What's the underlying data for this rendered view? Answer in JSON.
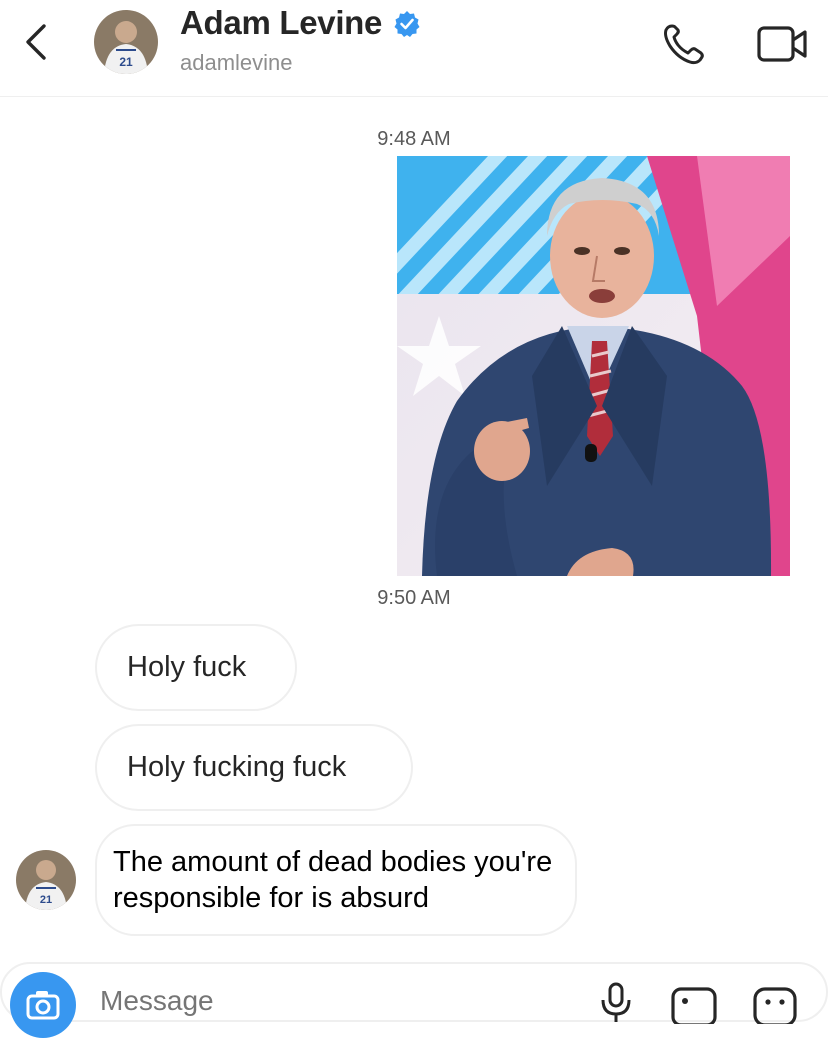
{
  "header": {
    "name": "Adam Levine",
    "handle": "adamlevine",
    "verified": true,
    "icons": [
      "back-chevron-icon",
      "verified-badge-icon",
      "phone-icon",
      "video-camera-icon"
    ]
  },
  "thread": {
    "timestamps": [
      "9:48 AM",
      "9:50 AM"
    ],
    "messages": [
      {
        "from": "them",
        "text": "Holy fuck"
      },
      {
        "from": "them",
        "text": "Holy fucking fuck"
      },
      {
        "from": "them",
        "text": "The amount of dead bodies you're responsible for is absurd"
      }
    ]
  },
  "composer": {
    "placeholder": "Message",
    "icons": [
      "camera-icon",
      "microphone-icon",
      "gallery-icon",
      "sticker-icon"
    ]
  },
  "colors": {
    "accent": "#3897f0",
    "verified": "#3897f0",
    "border": "#efefef",
    "muted": "#8e8e8e"
  }
}
